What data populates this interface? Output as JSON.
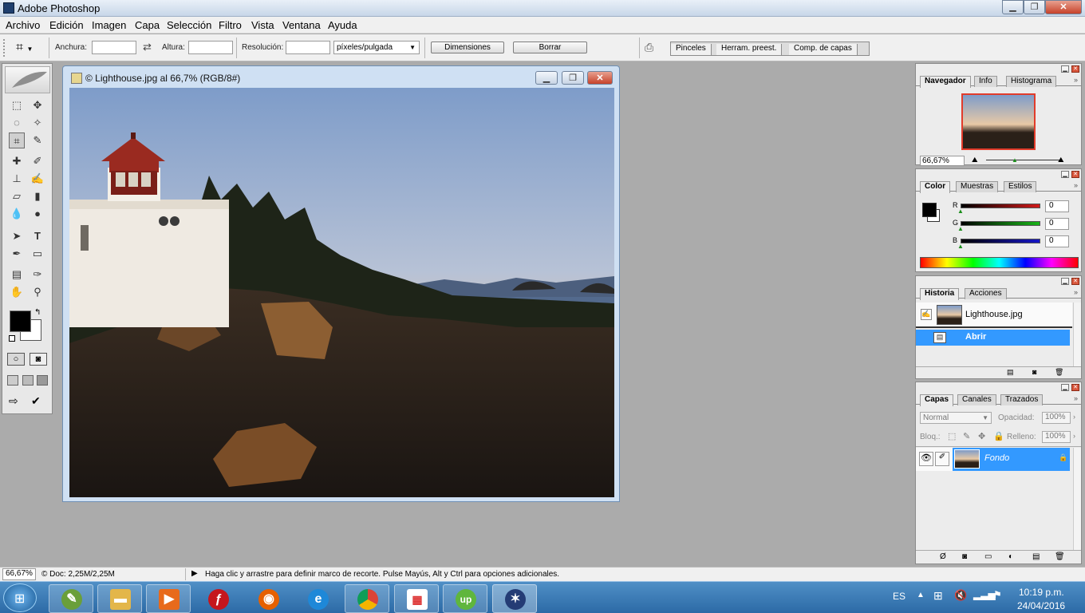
{
  "app": {
    "title": "Adobe Photoshop",
    "window_buttons": [
      "▁",
      "❐",
      "✕"
    ]
  },
  "menu": [
    "Archivo",
    "Edición",
    "Imagen",
    "Capa",
    "Selección",
    "Filtro",
    "Vista",
    "Ventana",
    "Ayuda"
  ],
  "options_bar": {
    "anchura_label": "Anchura:",
    "altura_label": "Altura:",
    "resolucion_label": "Resolución:",
    "unit_select": "píxeles/pulgada",
    "dimensiones_button": "Dimensiones",
    "borrar_button": "Borrar",
    "tabs": [
      "Pinceles",
      "Herram. preest.",
      "Comp. de capas"
    ]
  },
  "document": {
    "title": "© Lighthouse.jpg al 66,7% (RGB/8#)"
  },
  "navigator_panel": {
    "tabs": [
      "Navegador",
      "Info",
      "Histograma"
    ],
    "active_tab": "Navegador",
    "zoom": "66,67%"
  },
  "color_panel": {
    "tabs": [
      "Color",
      "Muestras",
      "Estilos"
    ],
    "active_tab": "Color",
    "channels": [
      {
        "label": "R",
        "value": "0",
        "color": "#d21a1a"
      },
      {
        "label": "G",
        "value": "0",
        "color": "#18b418"
      },
      {
        "label": "B",
        "value": "0",
        "color": "#1616c8"
      }
    ]
  },
  "history_panel": {
    "tabs": [
      "Historia",
      "Acciones"
    ],
    "active_tab": "Historia",
    "snapshot": "Lighthouse.jpg",
    "states": [
      "Abrir"
    ]
  },
  "layers_panel": {
    "tabs": [
      "Capas",
      "Canales",
      "Trazados"
    ],
    "active_tab": "Capas",
    "blend_mode": "Normal",
    "opacity_label": "Opacidad:",
    "opacity_value": "100%",
    "lock_label": "Bloq.:",
    "fill_label": "Relleno:",
    "fill_value": "100%",
    "layers": [
      {
        "name": "Fondo",
        "locked": true
      }
    ]
  },
  "status_bar": {
    "zoom": "66,67%",
    "doc_info": "© Doc: 2,25M/2,25M",
    "hint": "Haga clic y arrastre para definir marco de recorte. Pulse Mayús, Alt y Ctrl para opciones adicionales."
  },
  "taskbar": {
    "language": "ES",
    "time": "10:19 p.m.",
    "date": "24/04/2016",
    "apps": [
      "photoshop-painter",
      "file-explorer",
      "media-player",
      "flash-app",
      "firefox",
      "internet-explorer",
      "chrome",
      "apps-grid",
      "upwork",
      "photoshop-active"
    ]
  },
  "colors": {
    "accent_selection": "#3399ff",
    "taskbar": "#3a7ab8",
    "workspace": "#ababab"
  }
}
